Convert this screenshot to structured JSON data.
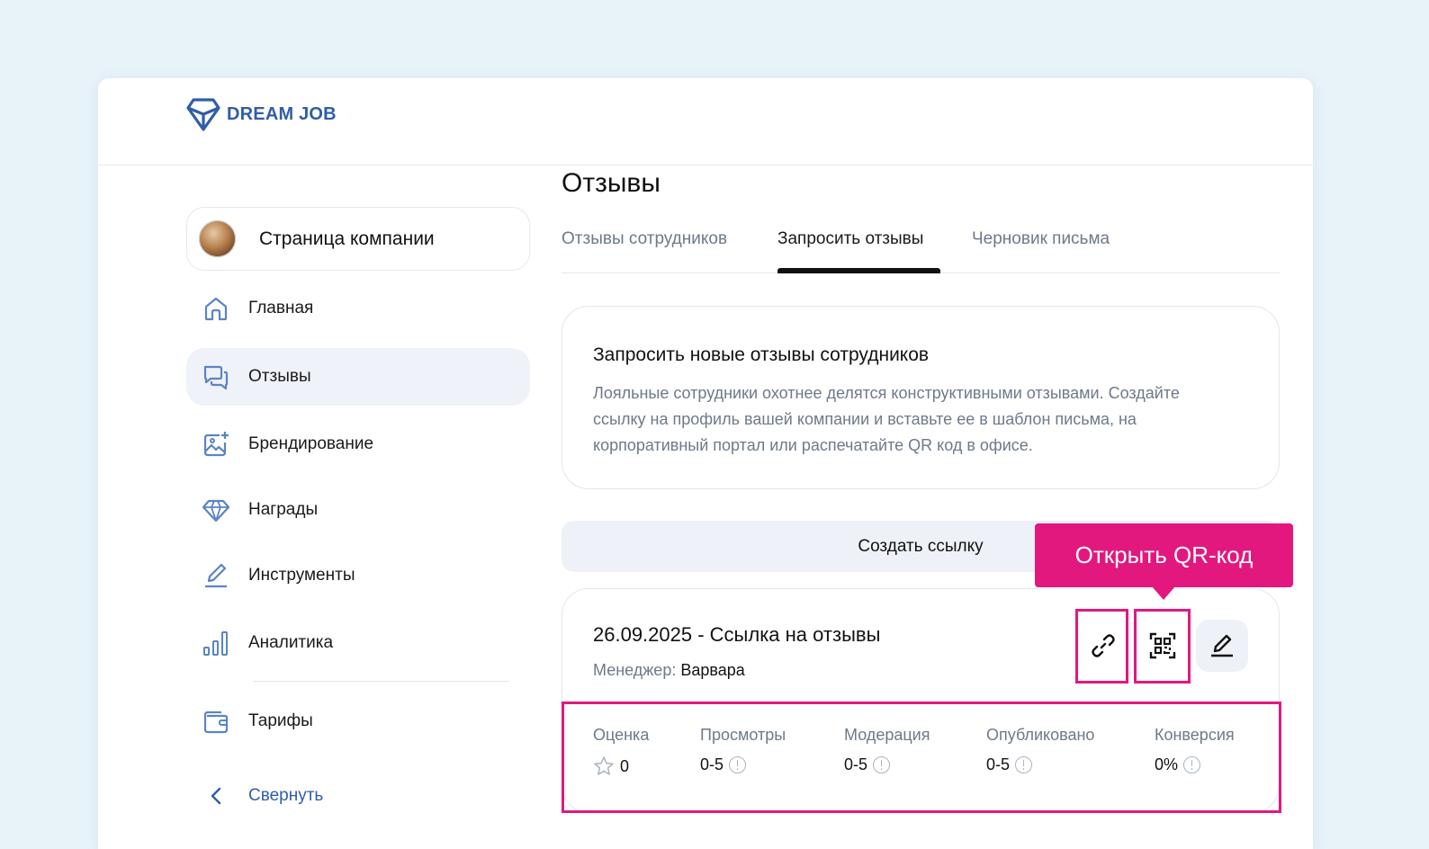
{
  "brand": {
    "name": "DREAM JOB",
    "color": "#2f5ea8"
  },
  "sidebar": {
    "company": {
      "name": "Страница компании"
    },
    "items": [
      {
        "label": "Главная",
        "icon": "home-icon"
      },
      {
        "label": "Отзывы",
        "icon": "chat-icon",
        "active": true
      },
      {
        "label": "Брендирование",
        "icon": "image-plus-icon"
      },
      {
        "label": "Награды",
        "icon": "diamond-icon"
      },
      {
        "label": "Инструменты",
        "icon": "pencil-icon"
      },
      {
        "label": "Аналитика",
        "icon": "bar-chart-icon"
      },
      {
        "label": "Тарифы",
        "icon": "wallet-icon"
      }
    ],
    "collapse_label": "Свернуть"
  },
  "main": {
    "title": "Отзывы",
    "tabs": [
      {
        "label": "Отзывы сотрудников"
      },
      {
        "label": "Запросить отзывы",
        "active": true
      },
      {
        "label": "Черновик письма"
      }
    ],
    "info_card": {
      "title": "Запросить новые отзывы сотрудников",
      "text": "Лояльные сотрудники охотнее делятся конструктивными отзывами. Создайте ссылку на профиль вашей компании и вставьте ее в шаблон письма, на корпоративный портал или распечатайте QR код в офисе."
    },
    "create_button": "Создать ссылку",
    "link_card": {
      "title": "26.09.2025 - Ссылка на отзывы",
      "manager_label": "Менеджер:",
      "manager_name": "Варвара",
      "stats": [
        {
          "label": "Оценка",
          "value": "0"
        },
        {
          "label": "Просмотры",
          "value": "0-5"
        },
        {
          "label": "Модерация",
          "value": "0-5"
        },
        {
          "label": "Опубликовано",
          "value": "0-5"
        },
        {
          "label": "Конверсия",
          "value": "0%"
        }
      ]
    }
  },
  "tooltip": {
    "text": "Открыть QR-код",
    "color": "#e2187f"
  }
}
